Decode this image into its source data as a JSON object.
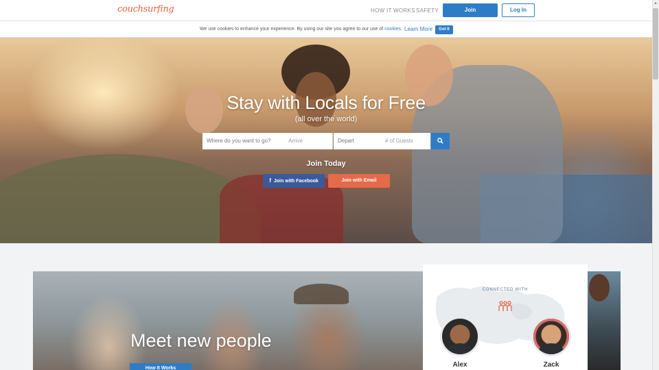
{
  "header": {
    "logo": "couchsurfing",
    "nav": [
      {
        "label": "HOW IT WORKS"
      },
      {
        "label": "SAFETY"
      }
    ],
    "join_label": "Join",
    "login_label": "Log In"
  },
  "cookie_bar": {
    "text_before": "We use cookies to enhance your experience. By using our site you agree to our use of ",
    "cookies_link": "cookies",
    "text_after": ".",
    "learn_more": "Learn More",
    "got_it": "Got It"
  },
  "hero": {
    "title": "Stay with Locals for Free",
    "subtitle": "(all over the world)",
    "search": {
      "where_placeholder": "Where do you want to go?",
      "arrive_placeholder": "Arrive",
      "depart_placeholder": "Depart",
      "guests_placeholder": "# of Guests",
      "search_icon": "search-icon"
    },
    "join_today": "Join Today",
    "facebook_label": "Join with Facebook",
    "facebook_icon": "f",
    "email_label": "Join with Email"
  },
  "feature": {
    "title": "Meet new people",
    "button_label": "How It Works"
  },
  "connected_card": {
    "label": "CONNECTED WITH",
    "people_icon": "people-group-icon",
    "people": [
      {
        "name": "Alex"
      },
      {
        "name": "Zack"
      }
    ]
  },
  "colors": {
    "brand_orange": "#e2603a",
    "primary_blue": "#2f7cc6",
    "facebook_blue": "#3b5a9a",
    "email_orange": "#e56a4a"
  }
}
